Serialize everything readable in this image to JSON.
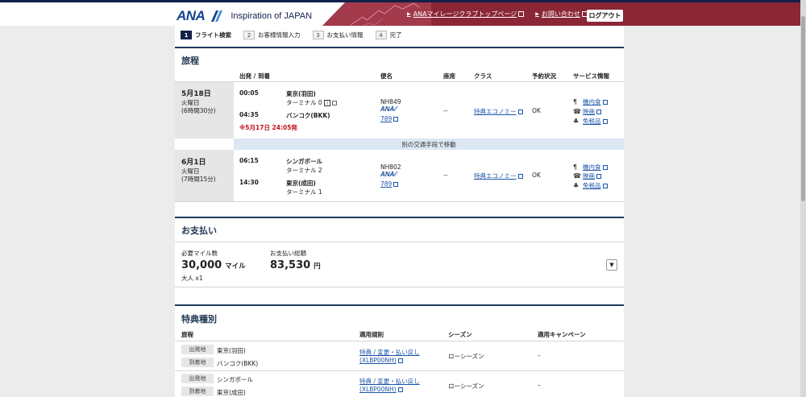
{
  "header": {
    "logo_text": "ANA",
    "tagline": "Inspiration of JAPAN",
    "nav_links": [
      {
        "label": "ANAマイレージクラブトップページ"
      },
      {
        "label": "お問い合わせ"
      }
    ],
    "logout_label": "ログアウト"
  },
  "steps": [
    {
      "num": "1",
      "label": "フライト検索"
    },
    {
      "num": "2",
      "label": "お客様情報入力"
    },
    {
      "num": "3",
      "label": "お支払い情報"
    },
    {
      "num": "4",
      "label": "完了"
    }
  ],
  "itinerary": {
    "title": "旅程",
    "columns": {
      "depart_arrive": "出発 / 到着",
      "flight": "便名",
      "seat": "座席",
      "class": "クラス",
      "status": "予約状況",
      "service": "サービス情報"
    },
    "segments": [
      {
        "date": "5月18日",
        "weekday": "火曜日",
        "duration": "(6時間30分)",
        "dep_time": "00:05",
        "dep_airport": "東京(羽田)",
        "dep_terminal": "ターミナル 0",
        "arr_time": "04:35",
        "arr_airport": "バンコク(BKK)",
        "arr_terminal": "",
        "note": "※5月17日 24:05発",
        "flight_no": "NH849",
        "carrier": "ANA",
        "aircraft": "789",
        "seat": "--",
        "class": "特典エコノミー",
        "status": "OK",
        "services": [
          "機内食",
          "映画",
          "免税品"
        ]
      },
      {
        "date": "6月1日",
        "weekday": "火曜日",
        "duration": "(7時間15分)",
        "dep_time": "06:15",
        "dep_airport": "シンガポール",
        "dep_terminal": "ターミナル 2",
        "arr_time": "14:30",
        "arr_airport": "東京(成田)",
        "arr_terminal": "ターミナル 1",
        "note": "",
        "flight_no": "NH802",
        "carrier": "ANA",
        "aircraft": "789",
        "seat": "--",
        "class": "特典エコノミー",
        "status": "OK",
        "services": [
          "機内食",
          "映画",
          "免税品"
        ]
      }
    ],
    "transfer_text": "別の交通手段で移動"
  },
  "payment": {
    "title": "お支払い",
    "miles_label": "必要マイル数",
    "miles_value": "30,000",
    "miles_unit": "マイル",
    "passengers": "大人 x1",
    "total_label": "お支払い総額",
    "total_value": "83,530",
    "total_unit": "円"
  },
  "award": {
    "title": "特典種別",
    "columns": {
      "itinerary": "旅程",
      "rules": "適用規則",
      "season": "シーズン",
      "campaign": "適用キャンペーン"
    },
    "dep_tag": "出発地",
    "arr_tag": "到着地",
    "rows": [
      {
        "dep": "東京(羽田)",
        "arr": "バンコク(BKK)",
        "rule": "特典 / 変更・払い戻し",
        "rule_code": "(XLBP00NH)",
        "season": "ローシーズン",
        "campaign": "–"
      },
      {
        "dep": "シンガポール",
        "arr": "東京(成田)",
        "rule": "特典 / 変更・払い戻し",
        "rule_code": "(XLBP00NH)",
        "season": "ローシーズン",
        "campaign": "–"
      }
    ]
  },
  "colors": {
    "brand_navy": "#13204a",
    "header_maroon": "#8a2636",
    "link_blue": "#1a55a8",
    "note_red": "#c0141b"
  }
}
